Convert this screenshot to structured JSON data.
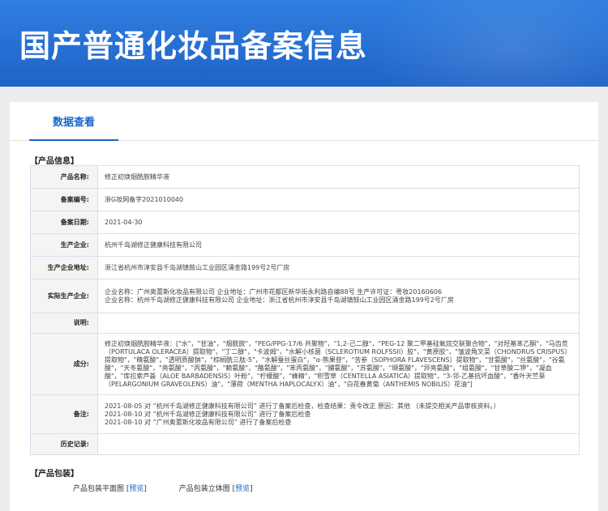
{
  "page": {
    "title": "国产普通化妆品备案信息",
    "tab_label": "数据查看"
  },
  "product_info": {
    "section_title": "【产品信息】",
    "rows": [
      {
        "label": "产品名称:",
        "value": "修正初焕烟酰胺精华液"
      },
      {
        "label": "备案编号:",
        "value": "浙G妆网备字2021010040"
      },
      {
        "label": "备案日期:",
        "value": "2021-04-30"
      },
      {
        "label": "生产企业:",
        "value": "杭州千岛湖修正健康科技有限公司"
      },
      {
        "label": "生产企业地址:",
        "value": "浙江省杭州市淳安县千岛湖镇鼓山工业园区涌金路199号2号厂房"
      },
      {
        "label": "实际生产企业:",
        "value": "企业名称：广州奥蕾斯化妆品有限公司 企业地址：广州市花都区新华街永利路自编88号 生产许可证：粤妆20160606\n企业名称：杭州千岛湖修正健康科技有限公司 企业地址：浙江省杭州市淳安县千岛湖镇鼓山工业园区涌金路199号2号厂房"
      },
      {
        "label": "说明:",
        "value": ""
      },
      {
        "label": "成分:",
        "value": "修正初焕烟酰胺精华液：[\"水\"，\"甘油\"，\"烟酰胺\"，\"PEG/PPG-17/6 共聚物\"，\"1,2-己二醇\"，\"PEG-12 聚二甲基硅氧烷交联聚合物\"，\"对羟基苯乙酮\"，\"马齿苋（PORTULACA OLERACEA）提取物\"，\"丁二醇\"，\"卡波姆\"，\"水解小核菌（SCLEROTIUM ROLFSSII）胶\"，\"黄原胶\"，\"皱波角叉菜（CHONDRUS CRISPUS）提取物\"，\"精氨酸\"，\"透明质酸钠\"，\"棕榈酰三肽-5\"，\"水解蚕丝蛋白\"，\"α-熊果苷\"，\"苦参（SOPHORA FLAVESCENS）提取物\"，\"甘氨酸\"，\"丝氨酸\"，\"谷氨酸\"，\"天冬氨酸\"，\"亮氨酸\"，\"丙氨酸\"，\"赖氨酸\"，\"酪氨酸\"，\"苯丙氨酸\"，\"脯氨酸\"，\"苏氨酸\"，\"缬氨酸\"，\"异亮氨酸\"，\"组氨酸\"，\"甘草酸二钾\"，\"凝血酸\"，\"库拉索芦荟（ALOE BARBADENSIS）叶粉\"，\"柠檬酸\"，\"蜂精\"，\"积雪草（CENTELLA ASIATICA）提取物\"，\"3-邻-乙基抗坏血酸\"，\"香叶天竺葵（PELARGONIUM GRAVEOLENS）油\"，\"薄荷（MENTHA HAPLOCALYX）油\"，\"白花春黄菊（ANTHEMIS NOBILIS）花油\"]"
      },
      {
        "label": "备注:",
        "value": "2021-08-05 对 “杭州千岛湖修正健康科技有限公司” 进行了备案后检查，检查结果：责令改正 原因：其他 （未提交相关产品审核资料。）\n2021-08-10 对 “杭州千岛湖修正健康科技有限公司” 进行了备案后检查\n2021-08-10 对 “广州奥蕾斯化妆品有限公司” 进行了备案后检查"
      },
      {
        "label": "历史记录:",
        "value": ""
      }
    ]
  },
  "packaging": {
    "section_title": "【产品包装】",
    "items": [
      {
        "label": "产品包装平面图",
        "link": "预览"
      },
      {
        "label": "产品包装立体图",
        "link": "预览"
      }
    ],
    "bracket_open": "[",
    "bracket_close": "]"
  }
}
